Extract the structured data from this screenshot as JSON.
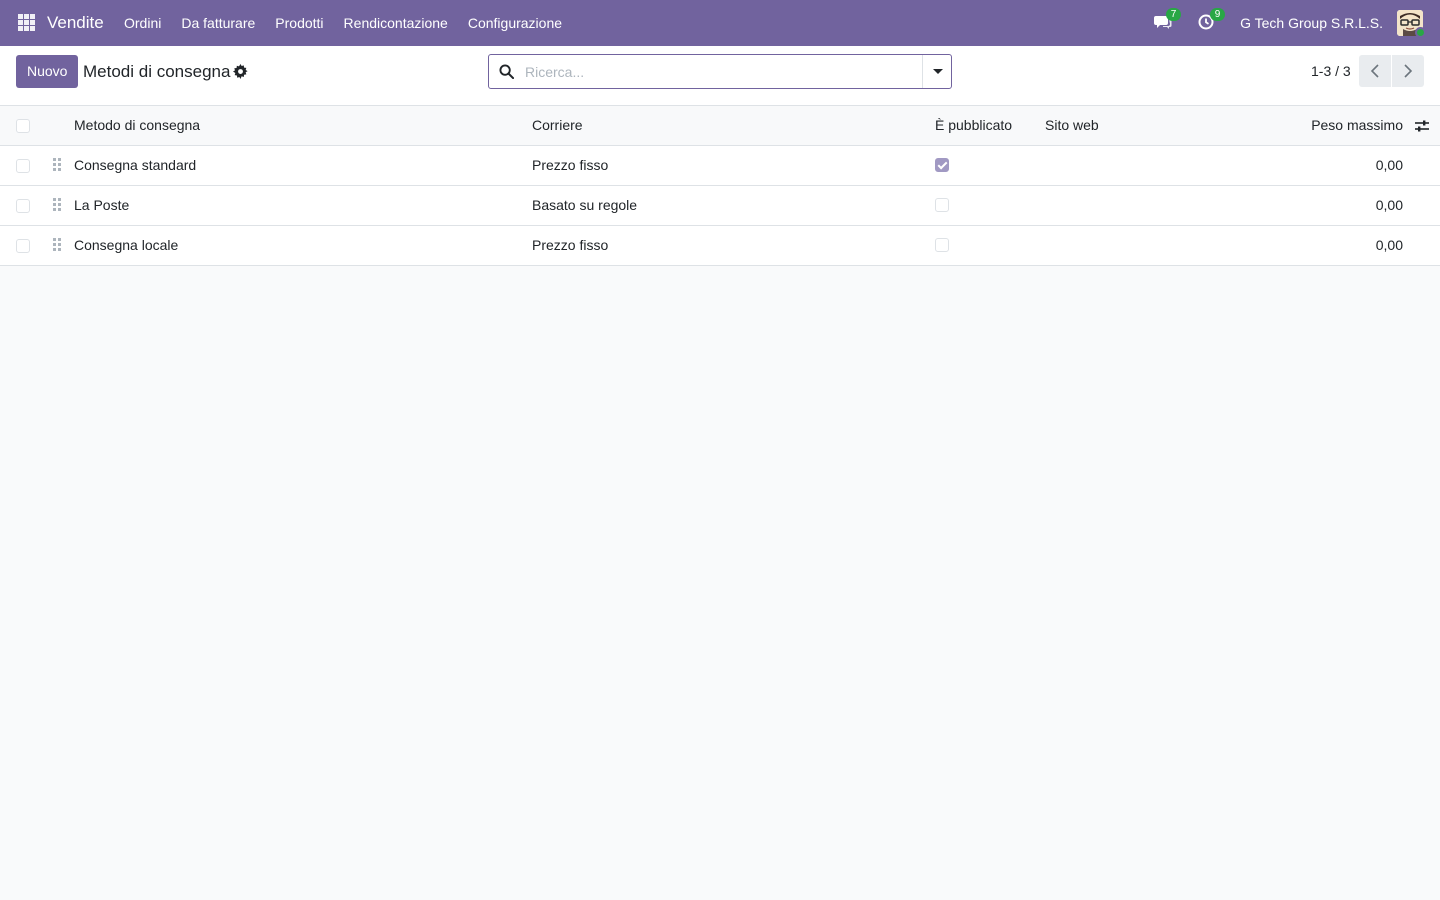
{
  "navbar": {
    "app_name": "Vendite",
    "menu": [
      "Ordini",
      "Da fatturare",
      "Prodotti",
      "Rendicontazione",
      "Configurazione"
    ],
    "messages_count": "7",
    "activities_count": "9",
    "company": "G Tech Group S.R.L.S."
  },
  "control_panel": {
    "new_label": "Nuovo",
    "title": "Metodi di consegna",
    "search_placeholder": "Ricerca...",
    "pager": "1-3 / 3"
  },
  "list": {
    "columns": {
      "name": "Metodo di consegna",
      "carrier": "Corriere",
      "published": "È pubblicato",
      "website": "Sito web",
      "weight": "Peso massimo"
    },
    "rows": [
      {
        "name": "Consegna standard",
        "carrier": "Prezzo fisso",
        "published": true,
        "website": "",
        "weight": "0,00"
      },
      {
        "name": "La Poste",
        "carrier": "Basato su regole",
        "published": false,
        "website": "",
        "weight": "0,00"
      },
      {
        "name": "Consegna locale",
        "carrier": "Prezzo fisso",
        "published": false,
        "website": "",
        "weight": "0,00"
      }
    ]
  },
  "colors": {
    "brand": "#71639e",
    "badge": "#28a745",
    "checked": "#a199c3"
  }
}
